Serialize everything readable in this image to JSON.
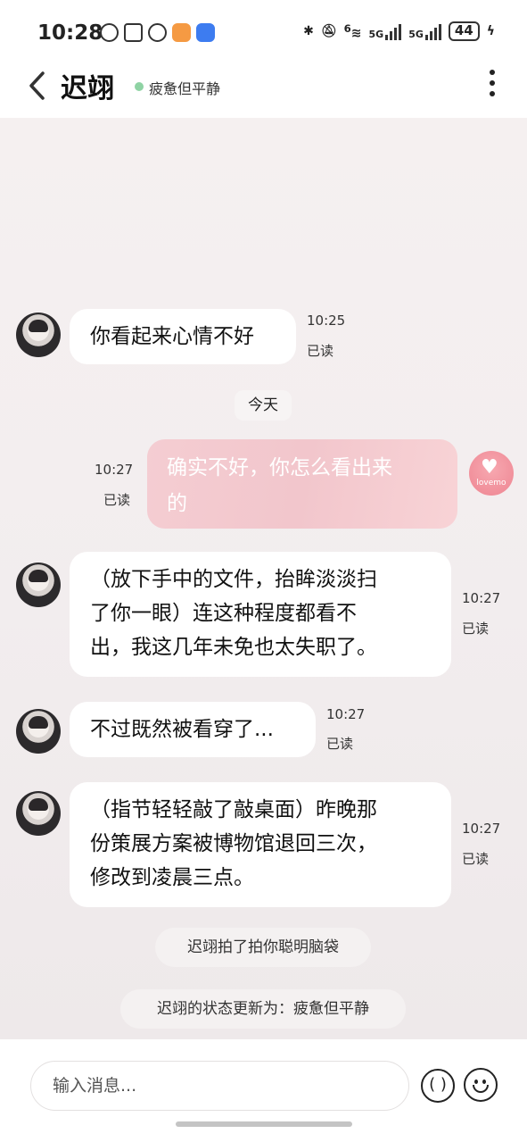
{
  "status_bar": {
    "time": "10:28",
    "battery": "44",
    "network_a": "5G",
    "network_b": "5G",
    "wifi_badge": "6"
  },
  "header": {
    "contact_name": "迟翊",
    "contact_status": "疲惫但平静",
    "status_color": "#8fd3a4"
  },
  "messages": [
    {
      "from": "them",
      "text": "你看起来心情不好",
      "time": "10:25",
      "read": "已读"
    },
    {
      "from": "me",
      "text_lines": [
        "确实不好，你怎么看出来",
        "的"
      ],
      "time": "10:27",
      "read": "已读"
    },
    {
      "from": "them",
      "text_lines": [
        "（放下手中的文件，抬眸淡淡扫",
        "了你一眼）连这种程度都看不",
        "出，我这几年未免也太失职了。"
      ],
      "time": "10:27",
      "read": "已读"
    },
    {
      "from": "them",
      "text": "不过既然被看穿了...",
      "time": "10:27",
      "read": "已读"
    },
    {
      "from": "them",
      "text_lines": [
        "（指节轻轻敲了敲桌面）昨晚那",
        "份策展方案被博物馆退回三次，",
        "修改到凌晨三点。"
      ],
      "time": "10:27",
      "read": "已读"
    }
  ],
  "day_label": "今天",
  "system_notices": [
    "迟翊拍了拍你聪明脑袋",
    "迟翊的状态更新为：疲惫但平静"
  ],
  "my_avatar_label": "lovemo",
  "input": {
    "placeholder": "输入消息..."
  },
  "voice_button_label": "( )",
  "colors": {
    "my_bubble": "#f2c6cc",
    "chat_bg": "#f3eeef",
    "accent_pink": "#ee8592"
  }
}
